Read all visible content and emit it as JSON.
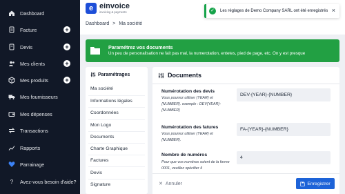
{
  "sidebar": {
    "items": [
      {
        "label": "Dashboard",
        "icon": "home-icon",
        "plus": false
      },
      {
        "label": "Facture",
        "icon": "document-icon",
        "plus": true
      },
      {
        "label": "Devis",
        "icon": "document-icon",
        "plus": true
      },
      {
        "label": "Mes clients",
        "icon": "users-icon",
        "plus": true
      },
      {
        "label": "Mes produits",
        "icon": "box-icon",
        "plus": true
      },
      {
        "label": "Mes fournisseurs",
        "icon": "truck-icon",
        "plus": false
      },
      {
        "label": "Mes dépenses",
        "icon": "wallet-icon",
        "plus": false
      },
      {
        "label": "Transactions",
        "icon": "transactions-icon",
        "plus": false
      },
      {
        "label": "Rapports",
        "icon": "chart-icon",
        "plus": false
      },
      {
        "label": "Parrainage",
        "icon": "heart-icon",
        "plus": false
      },
      {
        "label": "Avez-vous besoin d'aide?",
        "icon": "help-icon",
        "plus": false
      }
    ]
  },
  "logo": {
    "name": "einvoice",
    "tagline": "invoicing & payments"
  },
  "toast": {
    "message": "Les réglages de Demo Company SARL ont été enregistrés"
  },
  "breadcrumb": {
    "root": "Dashboard",
    "separator": ">",
    "current": "Ma société"
  },
  "banner": {
    "title": "Paramétrez vos documents",
    "text": "Un peu de personalisation ne fait pas mal, la numerotation, entetes, pied de page, etc. On y est presque"
  },
  "settings": {
    "title": "Paramétrages",
    "items": [
      "Ma société",
      "Informations légales",
      "Coordonnées",
      "Mon Logo",
      "Documents",
      "Charte Graphique",
      "Factures",
      "Devis",
      "Signature"
    ]
  },
  "documents": {
    "title": "Documents",
    "fields": [
      {
        "label": "Numérotation des devis",
        "help": "Vous pourrez utiliser {YEAR} et {NUMBER}. exemple : DEV{YEAR}-{NUMBER}",
        "value": "DEV-{YEAR}-{NUMBER}"
      },
      {
        "label": "Numérotation des fatures",
        "help": "Vous pourrez utiliser {YEAR} et {NUMBER}.",
        "value": "FA-{YEAR}-{NUMBER}"
      },
      {
        "label": "Nombre de numéros",
        "help": "Pour que vos numéros soient de la forme 0001, veuillez spécifier 4",
        "value": "4"
      }
    ]
  },
  "footer": {
    "cancel": "Annuler",
    "save": "Enregistrer"
  },
  "colors": {
    "sidebar": "#111827",
    "banner": "#22a043",
    "primary": "#1d63d8",
    "background": "#eef0f4"
  }
}
